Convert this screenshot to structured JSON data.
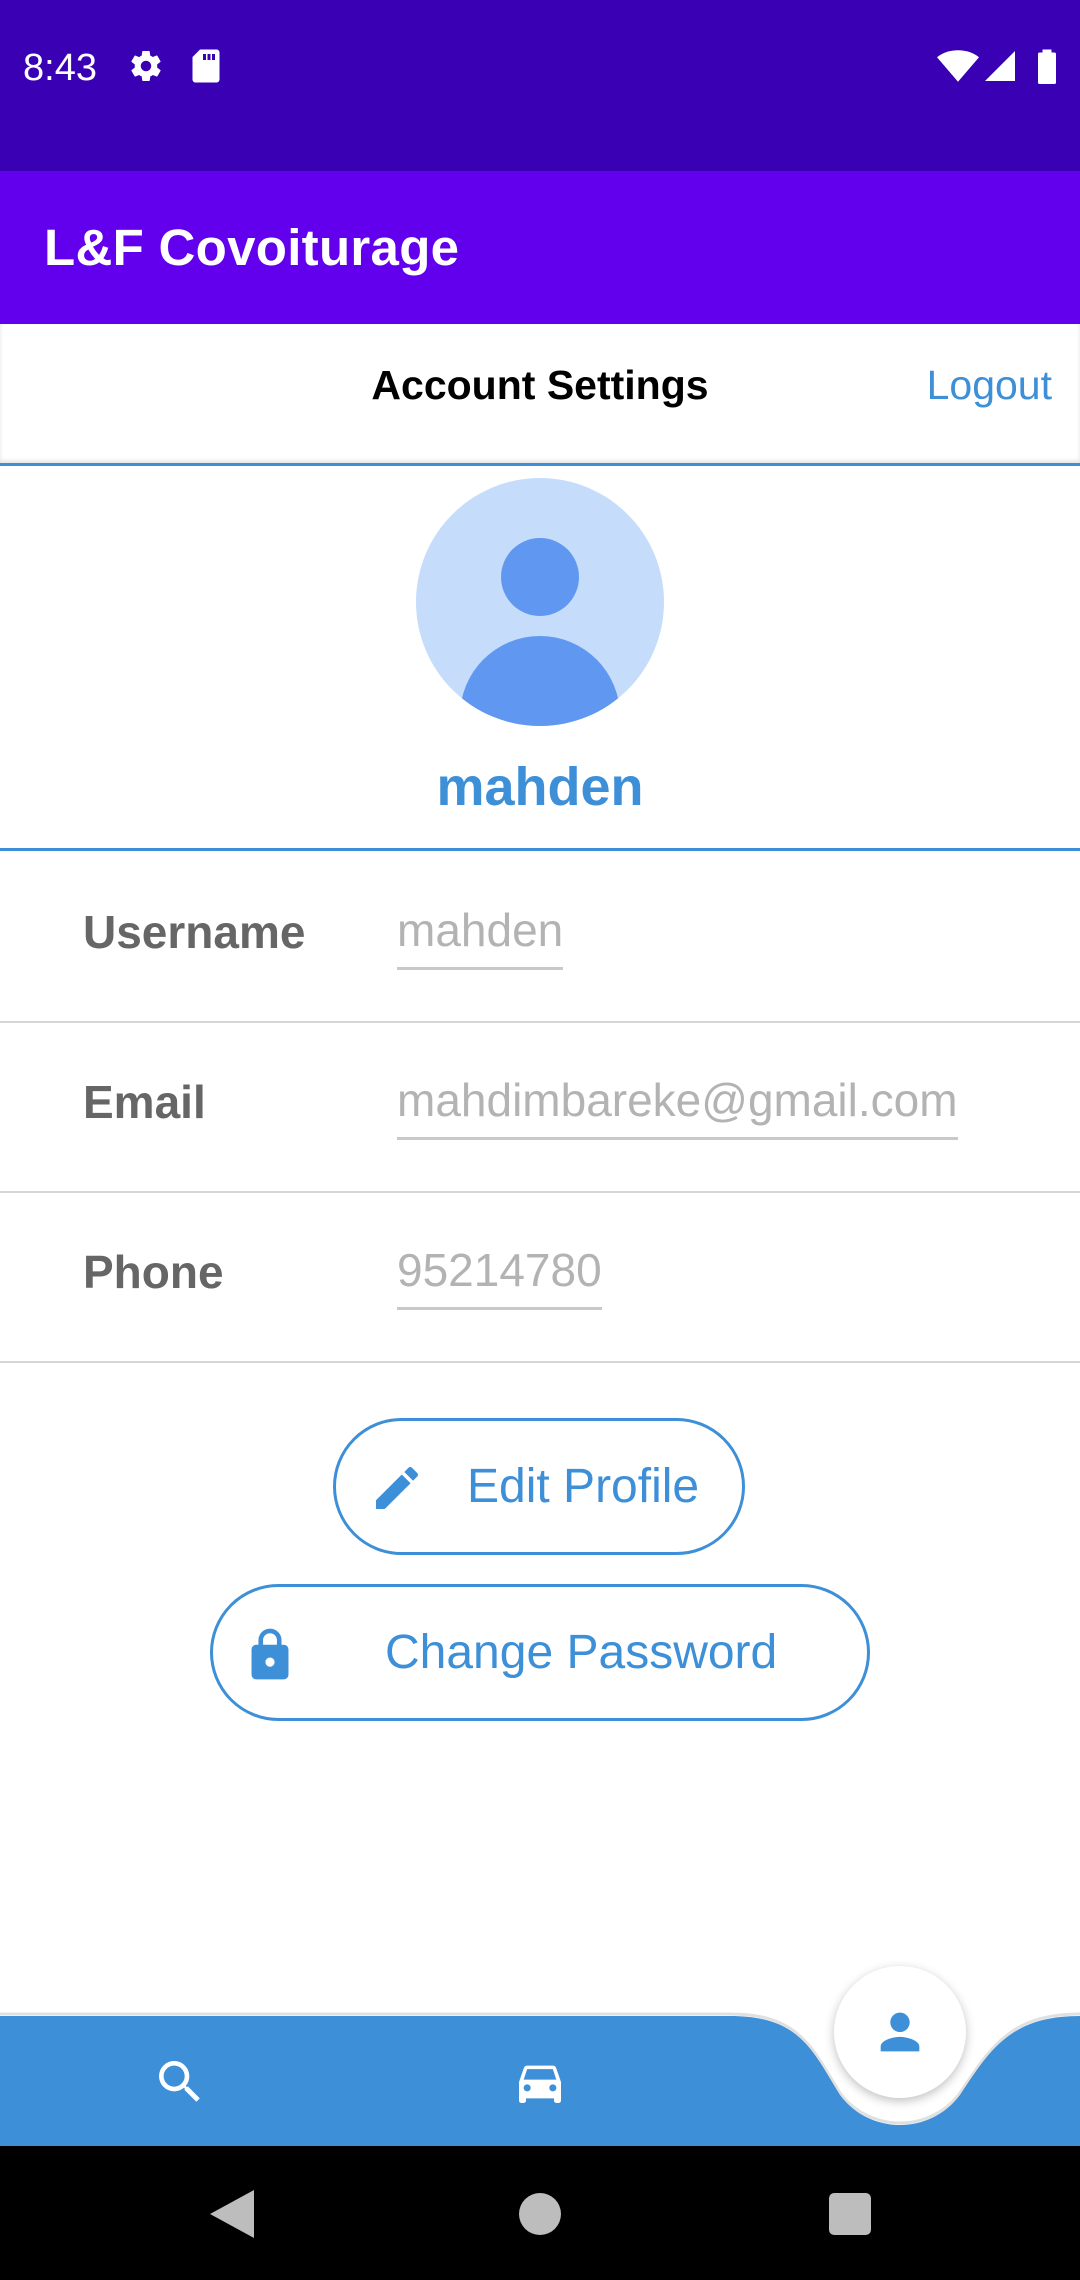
{
  "status_bar": {
    "time": "8:43",
    "left_icons": [
      "gear-icon",
      "sd-card-icon"
    ],
    "right_icons": [
      "wifi-icon",
      "signal-icon",
      "battery-icon"
    ]
  },
  "app_bar": {
    "title": "L&F Covoiturage",
    "color": "#6200ee"
  },
  "settings_header": {
    "title": "Account Settings",
    "logout_label": "Logout"
  },
  "profile": {
    "display_name": "mahden",
    "avatar_icon": "person-avatar-icon"
  },
  "fields": [
    {
      "label": "Username",
      "value": "mahden"
    },
    {
      "label": "Email",
      "value": "mahdimbareke@gmail.com"
    },
    {
      "label": "Phone",
      "value": "95214780"
    }
  ],
  "actions": {
    "edit_profile": "Edit Profile",
    "change_password": "Change Password"
  },
  "bottom_nav": {
    "items": [
      "search-icon",
      "car-icon",
      "person-icon"
    ],
    "active": "person-icon",
    "color": "#3d8fd8"
  },
  "system_nav": [
    "back-icon",
    "home-icon",
    "recents-icon"
  ],
  "colors": {
    "accent": "#3d8fd8",
    "status_bar": "#3a00b4"
  }
}
